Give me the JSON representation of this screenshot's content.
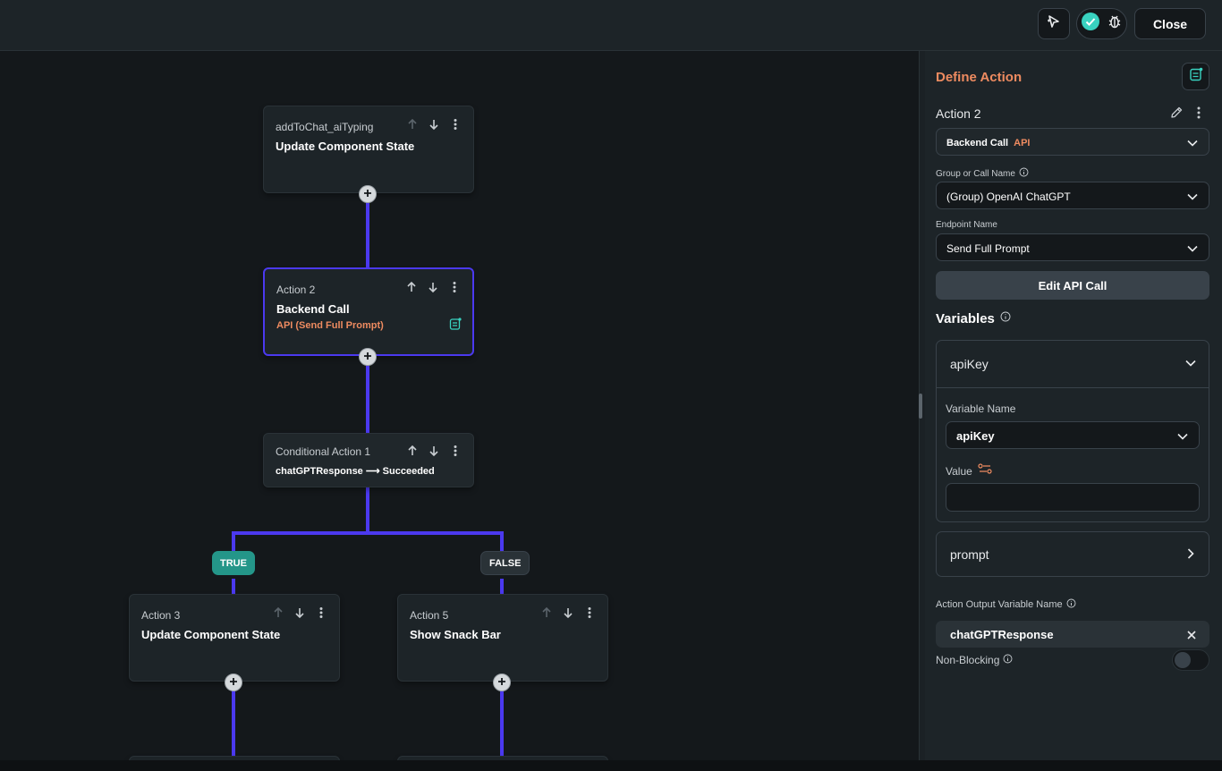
{
  "topbar": {
    "close_label": "Close"
  },
  "canvas": {
    "nodes": {
      "n1": {
        "subtitle": "addToChat_aiTyping",
        "title": "Update Component State"
      },
      "n2": {
        "subtitle": "Action 2",
        "title": "Backend Call",
        "api_label": "API (Send Full Prompt)"
      },
      "cond": {
        "subtitle": "Conditional Action 1",
        "condition": "chatGPTResponse ⟶ Succeeded"
      },
      "n3": {
        "subtitle": "Action 3",
        "title": "Update Component State"
      },
      "n5": {
        "subtitle": "Action 5",
        "title": "Show Snack Bar"
      }
    },
    "branches": {
      "true_label": "TRUE",
      "false_label": "FALSE"
    },
    "colors": {
      "wire": "#4b39ef",
      "true_badge": "#249689",
      "false_badge": "#2a3237"
    }
  },
  "panel": {
    "title": "Define Action",
    "action_name": "Action 2",
    "action_type": {
      "label": "Backend Call",
      "tag": "API"
    },
    "group_label": "Group or Call Name",
    "group_value": "(Group) OpenAI ChatGPT",
    "endpoint_label": "Endpoint Name",
    "endpoint_value": "Send Full Prompt",
    "edit_button": "Edit API Call",
    "variables_title": "Variables",
    "variables": [
      {
        "name": "apiKey",
        "var_name_label": "Variable Name",
        "var_name_value": "apiKey",
        "value_label": "Value",
        "value": ""
      },
      {
        "name": "prompt"
      }
    ],
    "output_label": "Action Output Variable Name",
    "output_value": "chatGPTResponse",
    "non_blocking_label": "Non-Blocking",
    "colors": {
      "accent": "#ee8b60",
      "teal": "#39d2c0"
    }
  }
}
